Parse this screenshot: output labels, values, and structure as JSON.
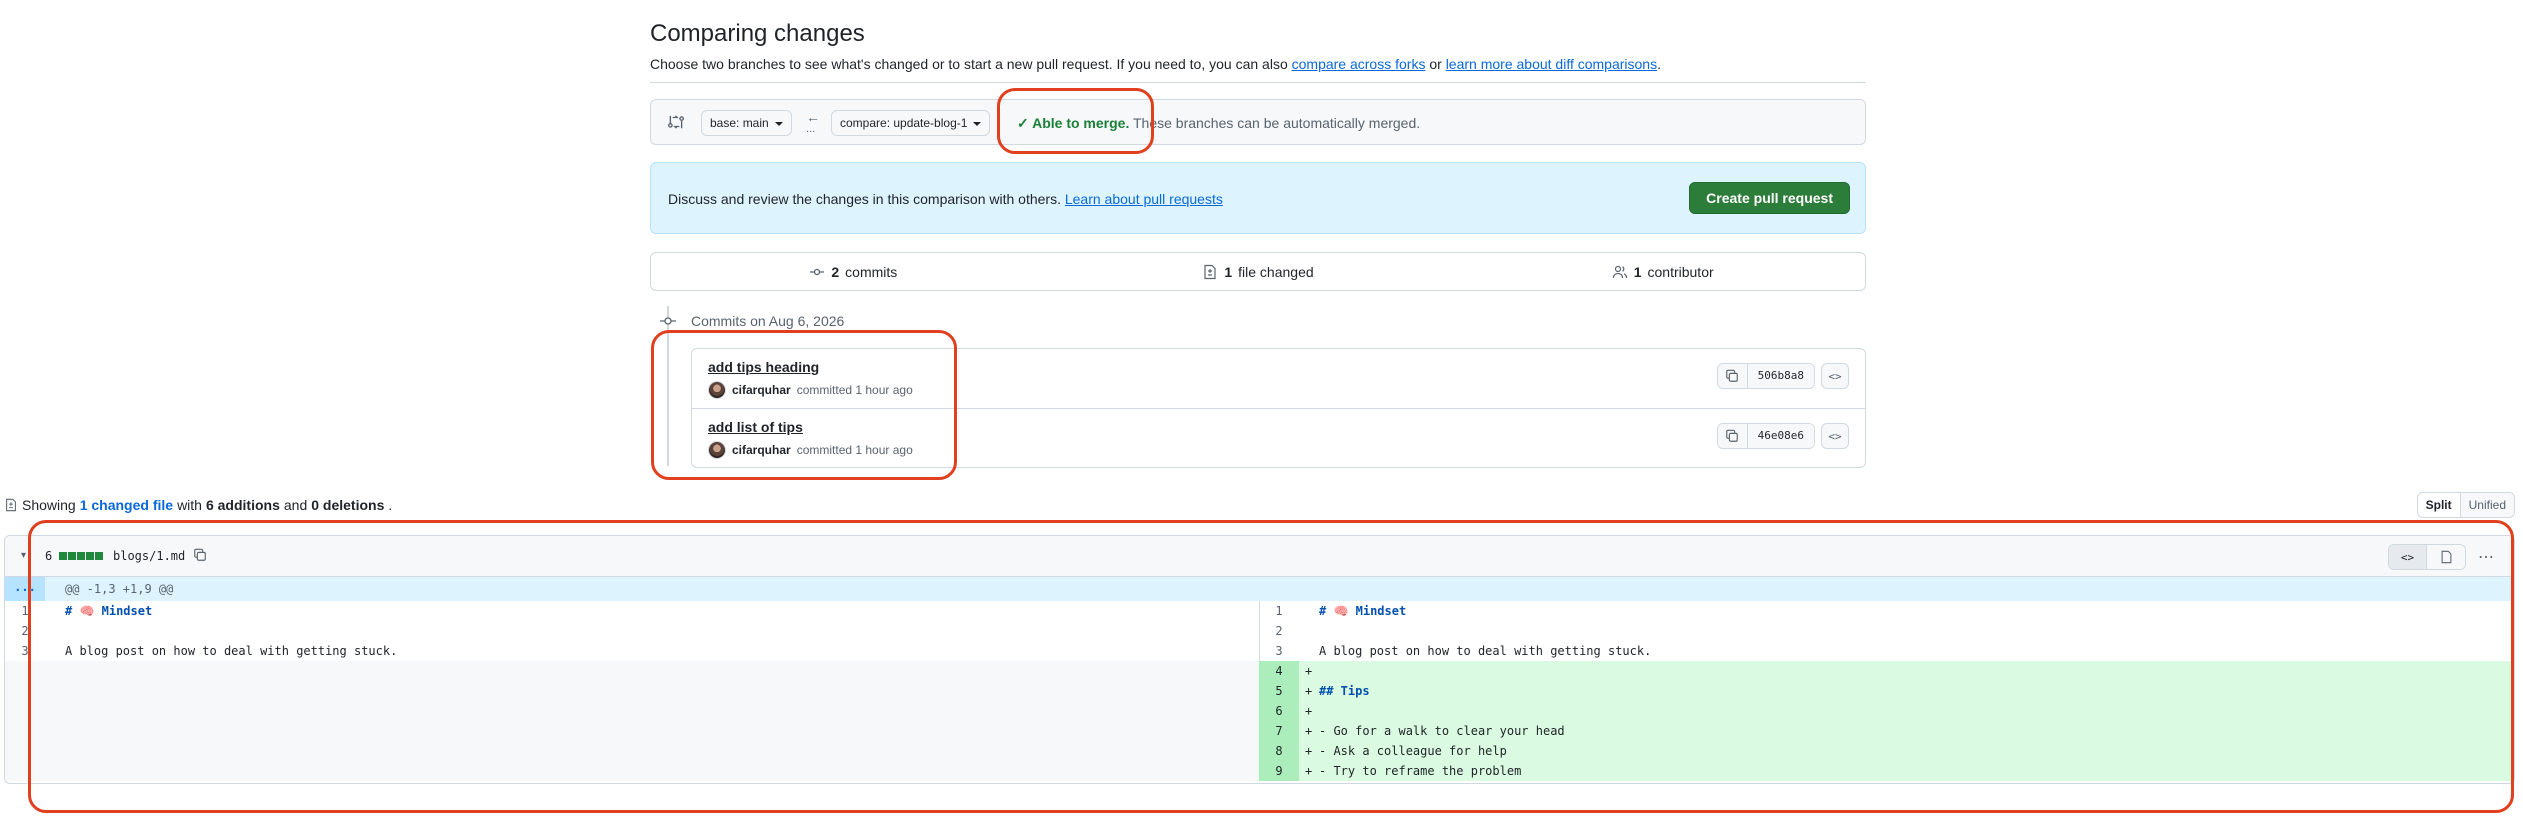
{
  "header": {
    "title": "Comparing changes",
    "subtitle_prefix": "Choose two branches to see what's changed or to start a new pull request. If you need to, you can also",
    "compare_forks_link": "compare across forks",
    "subtitle_or": "or",
    "learn_diff_link": "learn more about diff comparisons",
    "subtitle_end": "."
  },
  "range": {
    "base_label": "base: main",
    "compare_label": "compare: update-blog-1",
    "arrow": "←",
    "dots": "...",
    "merge_ok": "✓ Able to merge.",
    "merge_text": "These branches can be automatically merged."
  },
  "callout": {
    "text": "Discuss and review the changes in this comparison with others.",
    "link": "Learn about pull requests",
    "button": "Create pull request"
  },
  "summary": {
    "commits_count": "2",
    "commits_label": "commits",
    "files_count": "1",
    "files_label": "file changed",
    "contributors_count": "1",
    "contributors_label": "contributor"
  },
  "commits": {
    "date_label": "Commits on Aug 6, 2026",
    "items": [
      {
        "title": "add tips heading",
        "author": "cifarquhar",
        "meta": "committed 1 hour ago",
        "sha": "506b8a8"
      },
      {
        "title": "add list of tips",
        "author": "cifarquhar",
        "meta": "committed 1 hour ago",
        "sha": "46e08e6"
      }
    ]
  },
  "files_summary": {
    "prefix": "Showing",
    "changed_link": "1 changed file",
    "with": "with",
    "additions": "6 additions",
    "and": "and",
    "deletions": "0 deletions",
    "end": ".",
    "split_label": "Split",
    "unified_label": "Unified"
  },
  "file": {
    "change_count": "6",
    "name": "blogs/1.md",
    "hunk_expand": "...",
    "hunk_header": "@@ -1,3 +1,9 @@",
    "left_lines": [
      {
        "num": "1",
        "prefix": "",
        "heading": "# 🧠 Mindset",
        "text": ""
      },
      {
        "num": "2",
        "prefix": "",
        "heading": "",
        "text": ""
      },
      {
        "num": "3",
        "prefix": "",
        "heading": "",
        "text": "A blog post on how to deal with getting stuck."
      }
    ],
    "right_lines": [
      {
        "num": "1",
        "prefix": "",
        "heading": "# 🧠 Mindset",
        "text": ""
      },
      {
        "num": "2",
        "prefix": "",
        "heading": "",
        "text": ""
      },
      {
        "num": "3",
        "prefix": "",
        "heading": "",
        "text": "A blog post on how to deal with getting stuck."
      },
      {
        "num": "4",
        "prefix": "+",
        "heading": "",
        "text": ""
      },
      {
        "num": "5",
        "prefix": "+",
        "heading": "## Tips",
        "text": ""
      },
      {
        "num": "6",
        "prefix": "+",
        "heading": "",
        "text": ""
      },
      {
        "num": "7",
        "prefix": "+",
        "heading": "",
        "text": "- Go for a walk to clear your head"
      },
      {
        "num": "8",
        "prefix": "+",
        "heading": "",
        "text": "- Ask a colleague for help"
      },
      {
        "num": "9",
        "prefix": "+",
        "heading": "",
        "text": "- Try to reframe the problem"
      }
    ]
  },
  "colors": {
    "accent": "#0969da",
    "success": "#1a7f37",
    "primary_button": "#2d7d3a",
    "annotation": "#e0401e",
    "addition_bg": "#dafbe1"
  },
  "icons": {
    "swap": "git-compare-icon",
    "commit": "git-commit-icon",
    "file": "file-diff-icon",
    "people": "people-icon",
    "copy": "copy-icon",
    "code": "code-icon"
  }
}
